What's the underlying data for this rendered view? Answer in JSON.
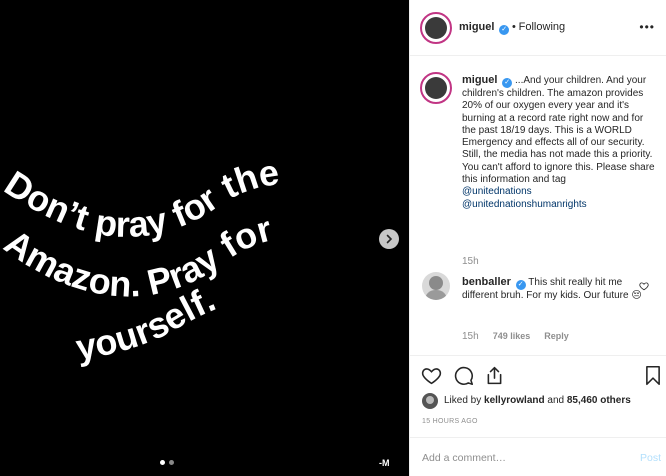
{
  "media": {
    "lines": [
      "Don’t pray for the",
      "Amazon. Pray for",
      "yourself."
    ],
    "watermark": "-M",
    "carousel_count": 2,
    "carousel_active": 0
  },
  "header": {
    "username": "miguel",
    "separator": "•",
    "follow_status": "Following",
    "more_label": "•••"
  },
  "caption": {
    "username": "miguel",
    "text": "...And your children. And your children's children. The amazon provides 20% of our oxygen every year and it's burning at a record rate right now and for the past 18/19 days. This is a WORLD Emergency and effects all of our security. Still, the media has not made this a priority. You can't afford to ignore this. Please share this information and tag",
    "mentions": [
      "@unitednations",
      "@unitednationshumanrights"
    ],
    "time": "15h"
  },
  "comment": {
    "username": "benballer",
    "text": "This shit really hit me different bruh. For my kids. Our future",
    "emoji": "😔",
    "time": "15h",
    "likes": "749 likes",
    "reply": "Reply"
  },
  "likes": {
    "prefix": "Liked by",
    "user": "kellyrowland",
    "middle": "and",
    "others": "85,460 others"
  },
  "timestamp": "15 HOURS AGO",
  "composer": {
    "placeholder": "Add a comment…",
    "post_label": "Post"
  },
  "colors": {
    "link": "#003569",
    "verified": "#3897f0",
    "muted": "#8e8e8e",
    "post_disabled": "#b2dffc"
  },
  "icons": [
    "heart-icon",
    "comment-icon",
    "share-icon",
    "bookmark-icon",
    "chevron-right-icon",
    "verified-icon",
    "more-icon"
  ]
}
